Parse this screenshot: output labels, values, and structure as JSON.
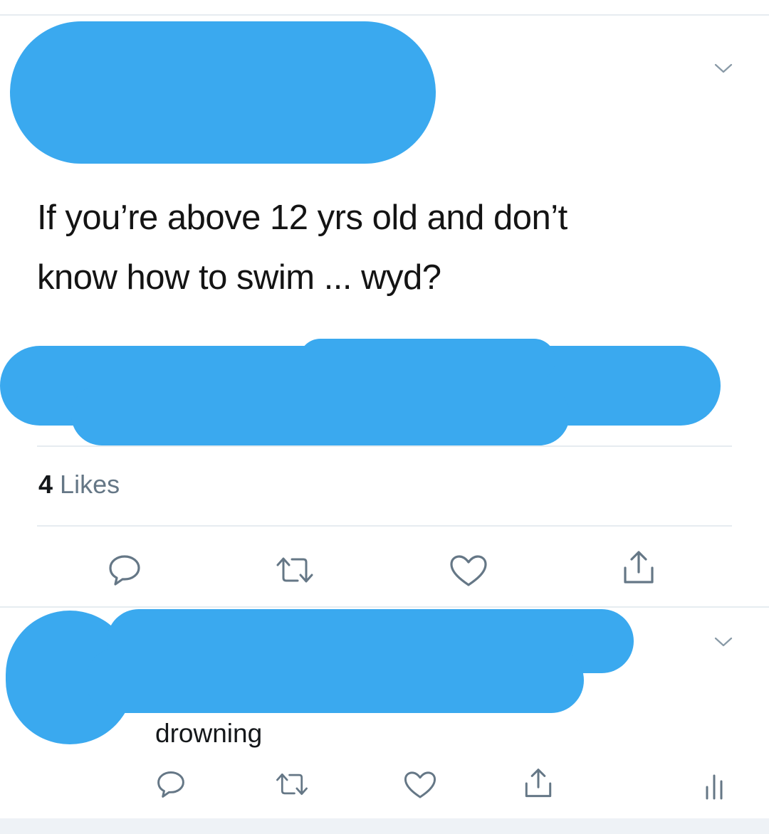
{
  "tweet": {
    "text": "If you’re above 12 yrs old and don’t\nknow how to swim ... wyd?",
    "likes_count": "4",
    "likes_label": "Likes",
    "actions": [
      "comment-icon",
      "retweet-icon",
      "heart-icon",
      "share-icon"
    ]
  },
  "reply": {
    "text": "drowning",
    "actions": [
      "comment-icon",
      "retweet-icon",
      "heart-icon",
      "share-icon",
      "analytics-icon"
    ]
  },
  "colors": {
    "redaction": "#3aa9ef",
    "icon_gray": "#657786",
    "divider": "#e6ecf0"
  }
}
